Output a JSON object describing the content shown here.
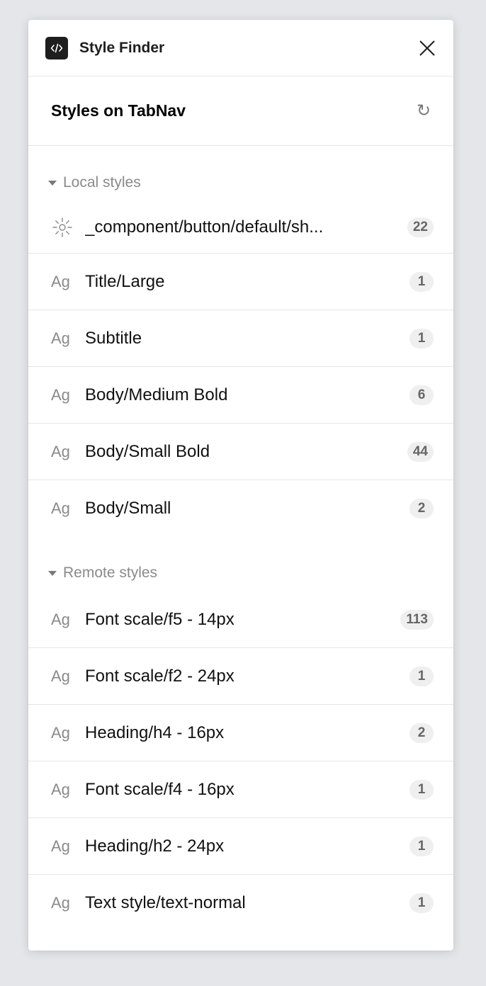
{
  "header": {
    "title": "Style Finder",
    "plugin_icon": "code-icon",
    "close_icon": "close-icon"
  },
  "subheader": {
    "title": "Styles on TabNav",
    "refresh_icon": "refresh-icon",
    "refresh_glyph": "↻"
  },
  "local": {
    "label": "Local styles",
    "items": [
      {
        "icon": "effect-icon",
        "label": "_component/button/default/sh...",
        "count": "22"
      },
      {
        "icon": "text-style-icon",
        "icon_text": "Ag",
        "label": "Title/Large",
        "count": "1"
      },
      {
        "icon": "text-style-icon",
        "icon_text": "Ag",
        "label": "Subtitle",
        "count": "1"
      },
      {
        "icon": "text-style-icon",
        "icon_text": "Ag",
        "label": "Body/Medium Bold",
        "count": "6"
      },
      {
        "icon": "text-style-icon",
        "icon_text": "Ag",
        "label": "Body/Small Bold",
        "count": "44"
      },
      {
        "icon": "text-style-icon",
        "icon_text": "Ag",
        "label": "Body/Small",
        "count": "2"
      }
    ]
  },
  "remote": {
    "label": "Remote styles",
    "items": [
      {
        "icon": "text-style-icon",
        "icon_text": "Ag",
        "label": "Font scale/f5 - 14px",
        "count": "113"
      },
      {
        "icon": "text-style-icon",
        "icon_text": "Ag",
        "label": "Font scale/f2 - 24px",
        "count": "1"
      },
      {
        "icon": "text-style-icon",
        "icon_text": "Ag",
        "label": "Heading/h4 - 16px",
        "count": "2"
      },
      {
        "icon": "text-style-icon",
        "icon_text": "Ag",
        "label": "Font scale/f4 - 16px",
        "count": "1"
      },
      {
        "icon": "text-style-icon",
        "icon_text": "Ag",
        "label": "Heading/h2 - 24px",
        "count": "1"
      },
      {
        "icon": "text-style-icon",
        "icon_text": "Ag",
        "label": "Text style/text-normal",
        "count": "1"
      }
    ]
  },
  "colors": {
    "background": "#e5e6e9",
    "panel": "#ffffff",
    "icon_dark": "#1e1e1e",
    "muted": "#8a8a8a",
    "badge_bg": "#efefef"
  }
}
